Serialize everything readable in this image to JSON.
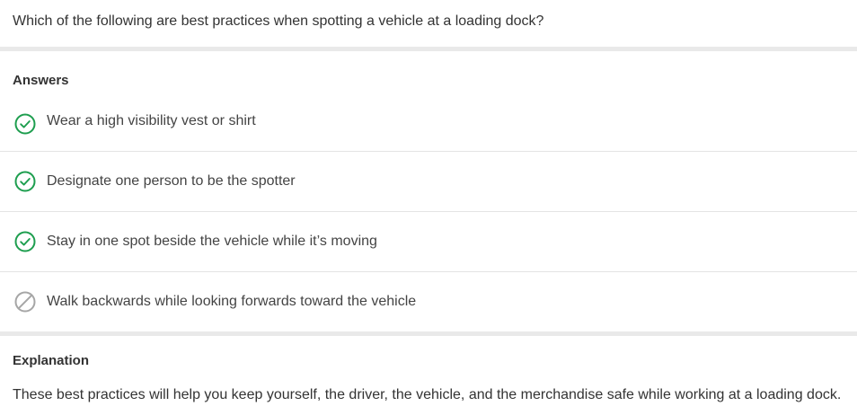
{
  "question": {
    "text": "Which of the following are best practices when spotting a vehicle at a loading dock?"
  },
  "answers": {
    "heading": "Answers",
    "items": [
      {
        "label": "Wear a high visibility vest or shirt",
        "status": "correct",
        "icon": "check-circle-icon"
      },
      {
        "label": "Designate one person to be the spotter",
        "status": "correct",
        "icon": "check-circle-icon"
      },
      {
        "label": "Stay in one spot beside the vehicle while it’s moving",
        "status": "correct",
        "icon": "check-circle-icon"
      },
      {
        "label": "Walk backwards while looking forwards toward the vehicle",
        "status": "incorrect",
        "icon": "prohibited-circle-icon"
      }
    ]
  },
  "explanation": {
    "heading": "Explanation",
    "text": "These best practices will help you keep yourself, the driver, the vehicle, and the merchandise safe while working at a loading dock."
  },
  "colors": {
    "correct": "#1e9e4f",
    "incorrect": "#a6a6a6",
    "divider": "#e9e9e9"
  }
}
